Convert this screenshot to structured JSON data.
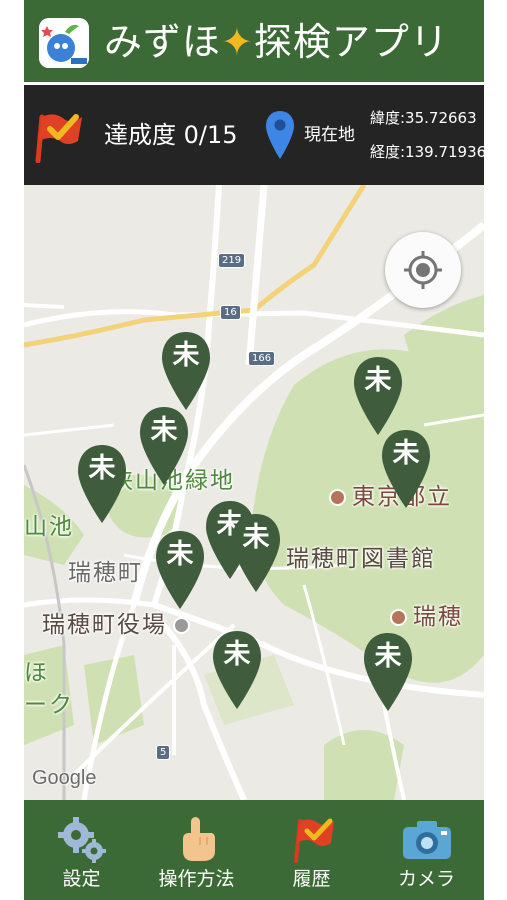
{
  "header": {
    "title_main": "みずほ",
    "title_sparkle": "✦",
    "title_rest": "探検アプリ",
    "logo_icon": "mizuho-character-logo-icon"
  },
  "status": {
    "progress": "達成度 0/15",
    "location_label": "現在地",
    "latitude": "緯度:35.72663",
    "longitude": "経度:139.71936"
  },
  "map": {
    "labels": {
      "park": "狭山池緑地",
      "library": "瑞穂町図書館",
      "tokyo": "東京都立",
      "town_office": "瑞穂町役場",
      "mizuho_right": "瑞穂",
      "mizuho_left": "瑞穂町",
      "pond": "山池",
      "left_mho": "ほ",
      "left_ku": "ーク"
    },
    "roads": [
      "219",
      "16",
      "166",
      "5"
    ],
    "attribution": "Google",
    "markers": [
      {
        "label": "未"
      },
      {
        "label": "未"
      },
      {
        "label": "未"
      },
      {
        "label": "未"
      },
      {
        "label": "未"
      },
      {
        "label": "未"
      },
      {
        "label": "未"
      },
      {
        "label": "未"
      },
      {
        "label": "未"
      },
      {
        "label": "未"
      }
    ],
    "marker_color": "#3f5c3c"
  },
  "nav": {
    "settings": "設定",
    "howto": "操作方法",
    "history": "履歴",
    "camera": "カメラ"
  },
  "colors": {
    "header_green": "#3c6a36",
    "status_bg": "#242424",
    "accent_yellow": "#f2b820",
    "pin_blue": "#3d86e6"
  }
}
